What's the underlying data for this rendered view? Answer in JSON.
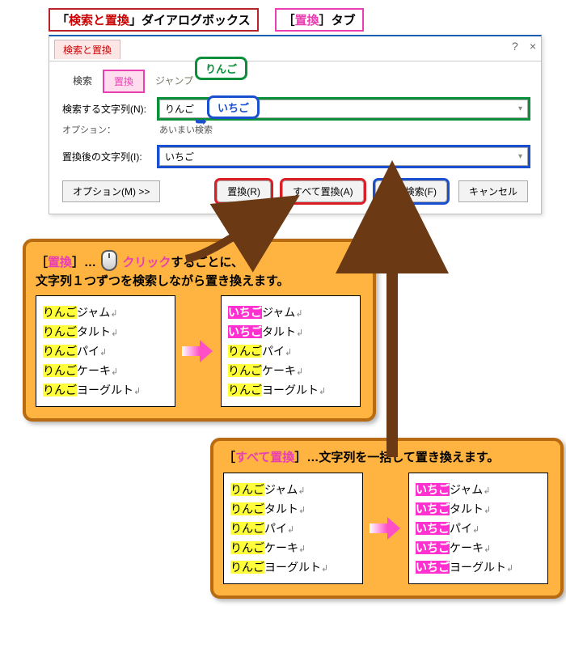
{
  "top": {
    "box_a_pre": "「",
    "box_a_red": "検索と置換",
    "box_a_post": "」ダイアログボックス",
    "box_b_pre": "［",
    "box_b_pink": "置換",
    "box_b_post": "］タブ"
  },
  "dialog": {
    "title_tab": "検索と置換",
    "help": "?",
    "close": "×",
    "tabs": {
      "search": "検索",
      "replace": "置換",
      "jump": "ジャンプ"
    },
    "callout_find": "りんご",
    "callout_replace": "いちご",
    "find_label": "検索する文字列(N):",
    "find_value": "りんご",
    "options_label": "オプション：",
    "options_value": "あいまい検索",
    "replace_label": "置換後の文字列(I):",
    "replace_value": "いちご",
    "btn_options": "オプション(M) >>",
    "btn_replace": "置換(R)",
    "btn_replace_all": "すべて置換(A)",
    "btn_find_next": "次を検索(F)",
    "btn_cancel": "キャンセル"
  },
  "panel1": {
    "t1_pre": "［",
    "t1_pink": "置換",
    "t1_post": "］…",
    "t1_click": "クリック",
    "t1_rest": "するごとに、",
    "t2": "文字列１つずつを検索しながら置き換えます。"
  },
  "panel2": {
    "t_pre": "［",
    "t_pink": "すべて置換",
    "t_post": "］…文字列を一括して置き換えます。"
  },
  "words": {
    "ringo": "りんご",
    "ichigo": "いちご",
    "items": [
      "ジャム",
      "タルト",
      "パイ",
      "ケーキ",
      "ヨーグルト"
    ]
  },
  "ret": "↲"
}
